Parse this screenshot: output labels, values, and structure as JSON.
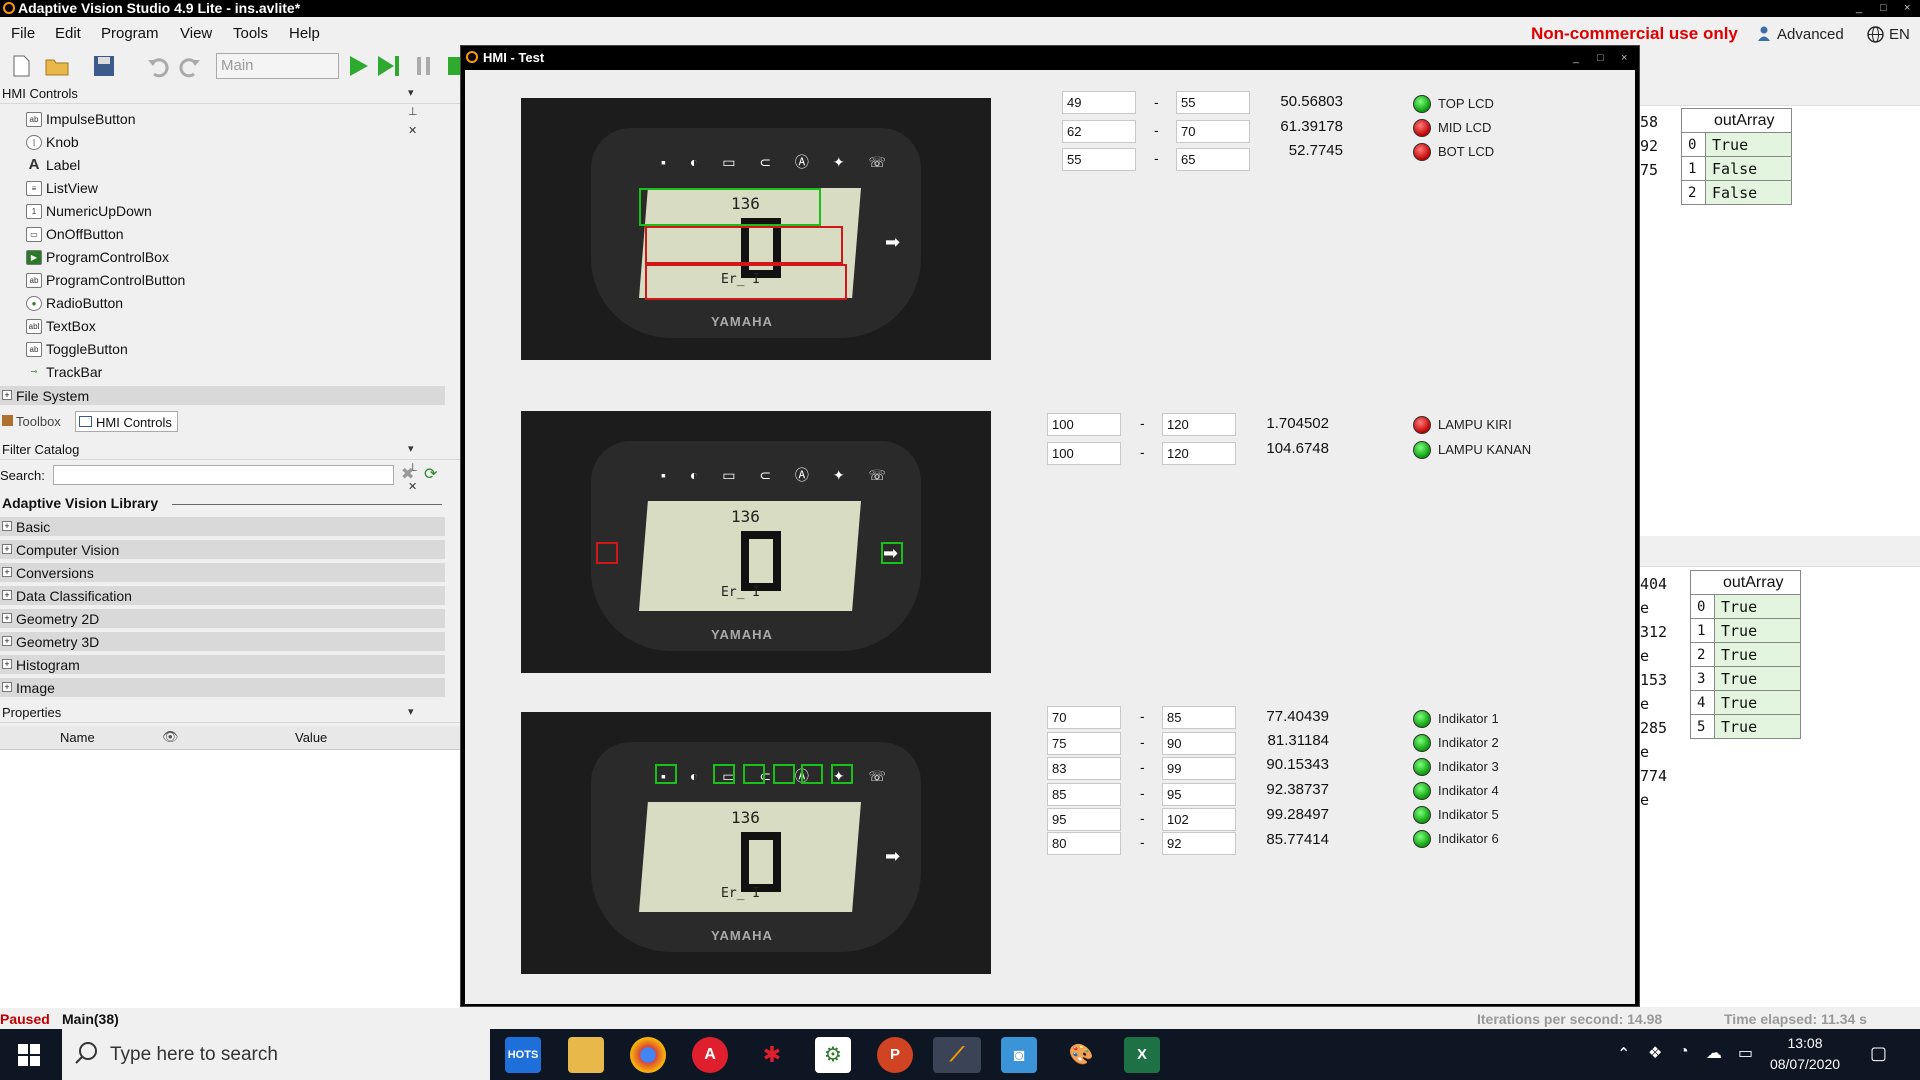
{
  "app": {
    "title": "Adaptive Vision Studio 4.9 Lite - ins.avlite*",
    "window_controls": [
      "_",
      "□",
      "×"
    ]
  },
  "menu": [
    "File",
    "Edit",
    "Program",
    "View",
    "Tools",
    "Help"
  ],
  "header_right": {
    "noncommercial": "Non-commercial use only",
    "mode": "Advanced",
    "language": "EN"
  },
  "toolbar": {
    "program_combo": "Main"
  },
  "hmi_controls_panel": {
    "title": "HMI Controls",
    "items": [
      "ImpulseButton",
      "Knob",
      "Label",
      "ListView",
      "NumericUpDown",
      "OnOffButton",
      "ProgramControlBox",
      "ProgramControlButton",
      "RadioButton",
      "TextBox",
      "ToggleButton",
      "TrackBar"
    ],
    "file_system": "File System",
    "tabs": [
      "Toolbox",
      "HMI Controls"
    ]
  },
  "filter_catalog": {
    "title": "Filter Catalog",
    "search_label": "Search:",
    "library": "Adaptive Vision Library",
    "groups": [
      "Basic",
      "Computer Vision",
      "Conversions",
      "Data Classification",
      "Geometry 2D",
      "Geometry 3D",
      "Histogram",
      "Image"
    ]
  },
  "properties": {
    "title": "Properties",
    "col_name": "Name",
    "col_value": "Value"
  },
  "hmi_window": {
    "title": "HMI - Test",
    "brand_text": "YAMAHA",
    "odo": "136",
    "err": "Er_ I",
    "lcd": {
      "rows": [
        {
          "min": "49",
          "max": "55",
          "value": "50.56803",
          "state": "on",
          "label": "TOP LCD"
        },
        {
          "min": "62",
          "max": "70",
          "value": "61.39178",
          "state": "off",
          "label": "MID LCD"
        },
        {
          "min": "55",
          "max": "65",
          "value": "52.7745",
          "state": "off",
          "label": "BOT LCD"
        }
      ]
    },
    "lamp": {
      "rows": [
        {
          "min": "100",
          "max": "120",
          "value": "1.704502",
          "state": "off",
          "label": "LAMPU KIRI"
        },
        {
          "min": "100",
          "max": "120",
          "value": "104.6748",
          "state": "on",
          "label": "LAMPU KANAN"
        }
      ]
    },
    "indicator": {
      "rows": [
        {
          "min": "70",
          "max": "85",
          "value": "77.40439",
          "state": "on",
          "label": "Indikator 1"
        },
        {
          "min": "75",
          "max": "90",
          "value": "81.31184",
          "state": "on",
          "label": "Indikator 2"
        },
        {
          "min": "83",
          "max": "99",
          "value": "90.15343",
          "state": "on",
          "label": "Indikator 3"
        },
        {
          "min": "85",
          "max": "95",
          "value": "92.38737",
          "state": "on",
          "label": "Indikator 4"
        },
        {
          "min": "95",
          "max": "102",
          "value": "99.28497",
          "state": "on",
          "label": "Indikator 5"
        },
        {
          "min": "80",
          "max": "92",
          "value": "85.77414",
          "state": "on",
          "label": "Indikator 6"
        }
      ]
    }
  },
  "array1": {
    "header": "outArray",
    "rows": [
      [
        "0",
        "True"
      ],
      [
        "1",
        "False"
      ],
      [
        "2",
        "False"
      ]
    ],
    "partial": [
      "58",
      "92",
      "75"
    ]
  },
  "array2": {
    "header": "outArray",
    "rows": [
      [
        "0",
        "True"
      ],
      [
        "1",
        "True"
      ],
      [
        "2",
        "True"
      ],
      [
        "3",
        "True"
      ],
      [
        "4",
        "True"
      ],
      [
        "5",
        "True"
      ]
    ],
    "partial": [
      "404",
      "e",
      "312",
      "e",
      "153",
      "e",
      "285",
      "e",
      "774",
      "e"
    ]
  },
  "status": {
    "state": "Paused",
    "location": "Main(38)",
    "ips": "Iterations per second: 14.98",
    "elapsed": "Time elapsed: 11.34 s"
  },
  "taskbar": {
    "search_placeholder": "Type here to search",
    "time": "13:08",
    "date": "08/07/2020",
    "apps": [
      "HOTS",
      "Files",
      "Chrome",
      "Adobe",
      "Paint",
      "Settings",
      "PowerPoint",
      "AVS",
      "Robot",
      "Palette",
      "Excel"
    ]
  }
}
